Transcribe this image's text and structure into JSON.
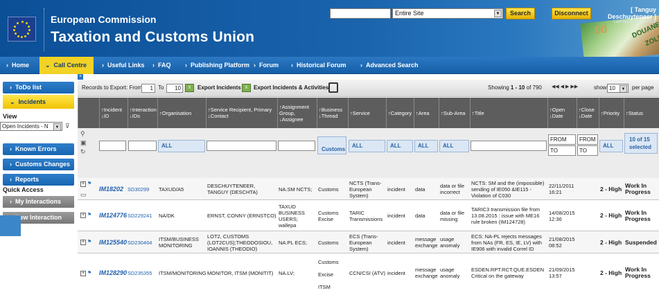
{
  "header": {
    "org": "European Commission",
    "site_title": "Taxation and Customs Union",
    "search_scope": "Entire Site",
    "search_label": "Search",
    "disconnect_label": "Disconnect",
    "user_name": "[ Tanguy Deschuyteneer ]",
    "last_logon": "Last logon: 25-02-2016",
    "banner_word1": "DOUANE",
    "banner_word2": "ZOLL",
    "banner_word3": "00"
  },
  "nav": {
    "items": [
      "Home",
      "Call Centre",
      "Useful Links",
      "FAQ",
      "Publishing Platform",
      "Forum",
      "Historical Forum",
      "Advanced Search"
    ],
    "active": "Call Centre"
  },
  "sidebar": {
    "todo": "ToDo list",
    "incidents": "Incidents",
    "view_label": "View",
    "view_value": "Open Incidents - N",
    "known_errors": "Known Errors",
    "customs_changes": "Customs Changes",
    "reports": "Reports",
    "quick_access": "Quick Access",
    "my_interactions": "My Interactions",
    "new_interaction": "New Interaction"
  },
  "toolbar": {
    "records_label": "Records to Export: From",
    "from": "1",
    "to_label": "To",
    "to": "10",
    "export_incidents": "Export Incidents",
    "export_activities": "Export Incidents & Activities",
    "showing_prefix": "Showing",
    "showing_range": "1 - 10",
    "showing_suffix": "of 790",
    "pager": "◀◀  ◀  ▶  ▶▶",
    "show_label": "show",
    "show_value": "10",
    "per_page": "per page"
  },
  "columns": [
    "↑Incident ↓ID",
    "↑Interaction ↓IDs",
    "↑Organisation",
    "↑Service Recipient, Primary ↓Contact",
    "↑Assignment Group, ↓Assignee",
    "↑Business ↓Thread",
    "↑Service",
    "↑Category",
    "↑Area",
    "↑Sub-Area",
    "↑Title",
    "↑Open ↓Date",
    "↑Close ↓Date",
    "↑Priority",
    "↑Status"
  ],
  "filters": {
    "all": "ALL",
    "business_thread": "Customs",
    "open_from": "FROM",
    "open_to": "TO",
    "close_from": "FROM",
    "close_to": "TO",
    "status": "10 of 15 selected"
  },
  "rows": [
    {
      "id": "IM18202",
      "interaction": "SD30299",
      "org": "TAXUD/A5",
      "recipient": "DESCHUYTENEER, TANGUY (DESCHTA)",
      "assignment": "NA.SM NCTS;",
      "thread": "Customs",
      "service": "NCTS (Trans-European System)",
      "category": "incident",
      "area": "data",
      "subarea": "data or file incorrect",
      "title": "NCTS: SM and the (impossible) sending of IE050 &IE115 - Violation of C030",
      "open": "22/11/2011 16:21",
      "close": "",
      "priority": "2 - High",
      "status": "Work In Progress"
    },
    {
      "id": "IM124776",
      "interaction": "SD229241",
      "org": "NA/DK",
      "recipient": "ERNST, CONNY (ERNSTCO)",
      "assignment": "TAXUD BUSINESS USERS; wallepa",
      "thread": "Customs Excise",
      "service": "TARIC Transmissions",
      "category": "incident",
      "area": "data",
      "subarea": "data or file missing",
      "title": "TARIC3 transmission file from 13.08.2015 : issue with ME16 rule broken (IM124728)",
      "open": "14/08/2015 12:36",
      "close": "",
      "priority": "2 - High",
      "status": "Work In Progress"
    },
    {
      "id": "IM125540",
      "interaction": "SD230464",
      "org": "ITSM/BUSINESS MONITORING",
      "recipient": "LOT2, CUSTOMS (LOT2CUS);THEODOSIOU, IOANNIS (THEODIO)",
      "assignment": "NA.PL ECS;",
      "thread": "Customs",
      "service": "ECS (Trans-European System)",
      "category": "incident",
      "area": "message exchange",
      "subarea": "usage anomaly",
      "title": "ECS: NA-PL rejects messages from NAs (FR, ES, IE, LV) with IE906 with invalid Correl ID",
      "open": "21/08/2015 08:52",
      "close": "",
      "priority": "2 - High",
      "status": "Suspended"
    },
    {
      "id": "IM128290",
      "interaction": "SD235355",
      "org": "ITSM/MONITORING",
      "recipient": "MONITOR, ITSM (MONITIT)",
      "assignment": "NA.LV;",
      "thread": "Customs Excise ITSM",
      "service": "CCN/CSI (ATV)",
      "category": "incident",
      "area": "message exchange",
      "subarea": "usage anomaly",
      "title": "ESDEN.RPT.RCT.QUE.ESDEN Critical on the gateway",
      "open": "21/09/2015 13:57",
      "close": "",
      "priority": "2 - High",
      "status": "Work In Progress"
    }
  ]
}
